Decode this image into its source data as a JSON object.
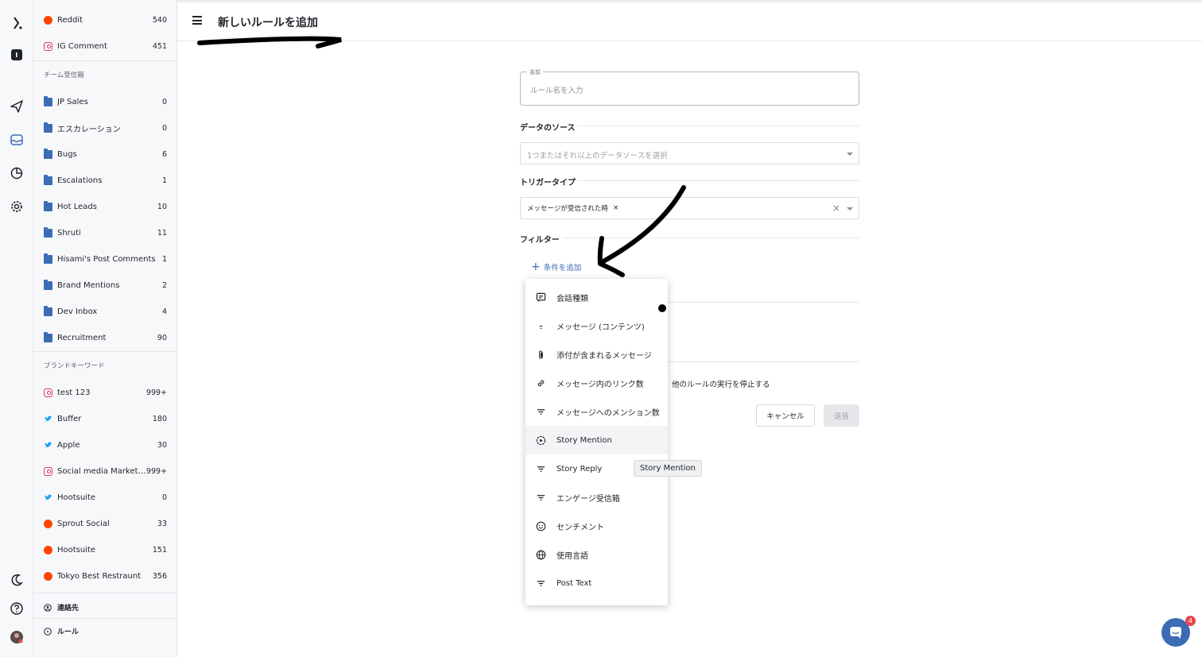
{
  "header": {
    "title": "新しいルールを追加"
  },
  "sidebar": {
    "top_items": [
      {
        "label": "Reddit",
        "count": "540",
        "icon": "reddit-icon"
      },
      {
        "label": "IG Comment",
        "count": "451",
        "icon": "instagram-icon"
      }
    ],
    "team_inbox_title": "チーム受信箱",
    "team_items": [
      {
        "label": "JP Sales",
        "count": "0"
      },
      {
        "label": "エスカレーション",
        "count": "0"
      },
      {
        "label": "Bugs",
        "count": "6"
      },
      {
        "label": "Escalations",
        "count": "1"
      },
      {
        "label": "Hot Leads",
        "count": "10"
      },
      {
        "label": "Shruti",
        "count": "11"
      },
      {
        "label": "Hisami's Post Comments",
        "count": "1"
      },
      {
        "label": "Brand Mentions",
        "count": "2"
      },
      {
        "label": "Dev Inbox",
        "count": "4"
      },
      {
        "label": "Recruitment",
        "count": "90"
      }
    ],
    "brand_keywords_title": "ブランドキーワード",
    "keyword_items": [
      {
        "label": "test 123",
        "count": "999+",
        "icon": "instagram-icon"
      },
      {
        "label": "Buffer",
        "count": "180",
        "icon": "twitter-icon"
      },
      {
        "label": "Apple",
        "count": "30",
        "icon": "twitter-icon"
      },
      {
        "label": "Social media Marketin...",
        "count": "999+",
        "icon": "instagram-icon"
      },
      {
        "label": "Hootsuite",
        "count": "0",
        "icon": "twitter-icon"
      },
      {
        "label": "Sprout Social",
        "count": "33",
        "icon": "reddit-icon"
      },
      {
        "label": "Hootsuite",
        "count": "151",
        "icon": "reddit-icon"
      },
      {
        "label": "Tokyo Best Restraunt",
        "count": "356",
        "icon": "reddit-icon"
      }
    ],
    "contacts_label": "連絡先",
    "rules_label": "ルール"
  },
  "form": {
    "name_legend": "名前",
    "name_placeholder": "ルール名を入力",
    "data_source_title": "データのソース",
    "data_source_placeholder": "1つまたはそれ以上のデータソースを選択",
    "trigger_title": "トリガータイプ",
    "trigger_chip": "メッセージが受信された時",
    "filter_title": "フィルター",
    "add_condition": "条件を追加",
    "stop_rules_text": "他のルールの実行を停止する",
    "cancel_label": "キャンセル",
    "send_label": "送信"
  },
  "menu": {
    "items": [
      {
        "label": "会話種類",
        "icon": "chat-icon"
      },
      {
        "label": "メッセージ (コンテンツ)",
        "icon": "text-icon"
      },
      {
        "label": "添付が含まれるメッセージ",
        "icon": "paperclip-icon"
      },
      {
        "label": "メッセージ内のリンク数",
        "icon": "link-icon"
      },
      {
        "label": "メッセージへのメンション数",
        "icon": "filter-icon"
      },
      {
        "label": "Story Mention",
        "icon": "story-icon"
      },
      {
        "label": "Story Reply",
        "icon": "filter-icon"
      },
      {
        "label": "エンゲージ受信箱",
        "icon": "filter-icon"
      },
      {
        "label": "センチメント",
        "icon": "smiley-icon"
      },
      {
        "label": "使用言語",
        "icon": "globe-icon"
      },
      {
        "label": "Post Text",
        "icon": "filter-icon"
      }
    ],
    "tooltip": "Story Mention"
  },
  "chat_widget": {
    "badge": "4"
  },
  "colors": {
    "accent": "#3b6cb5",
    "instagram": "#e1306c",
    "reddit": "#ff4500",
    "twitter": "#1da1f2"
  }
}
